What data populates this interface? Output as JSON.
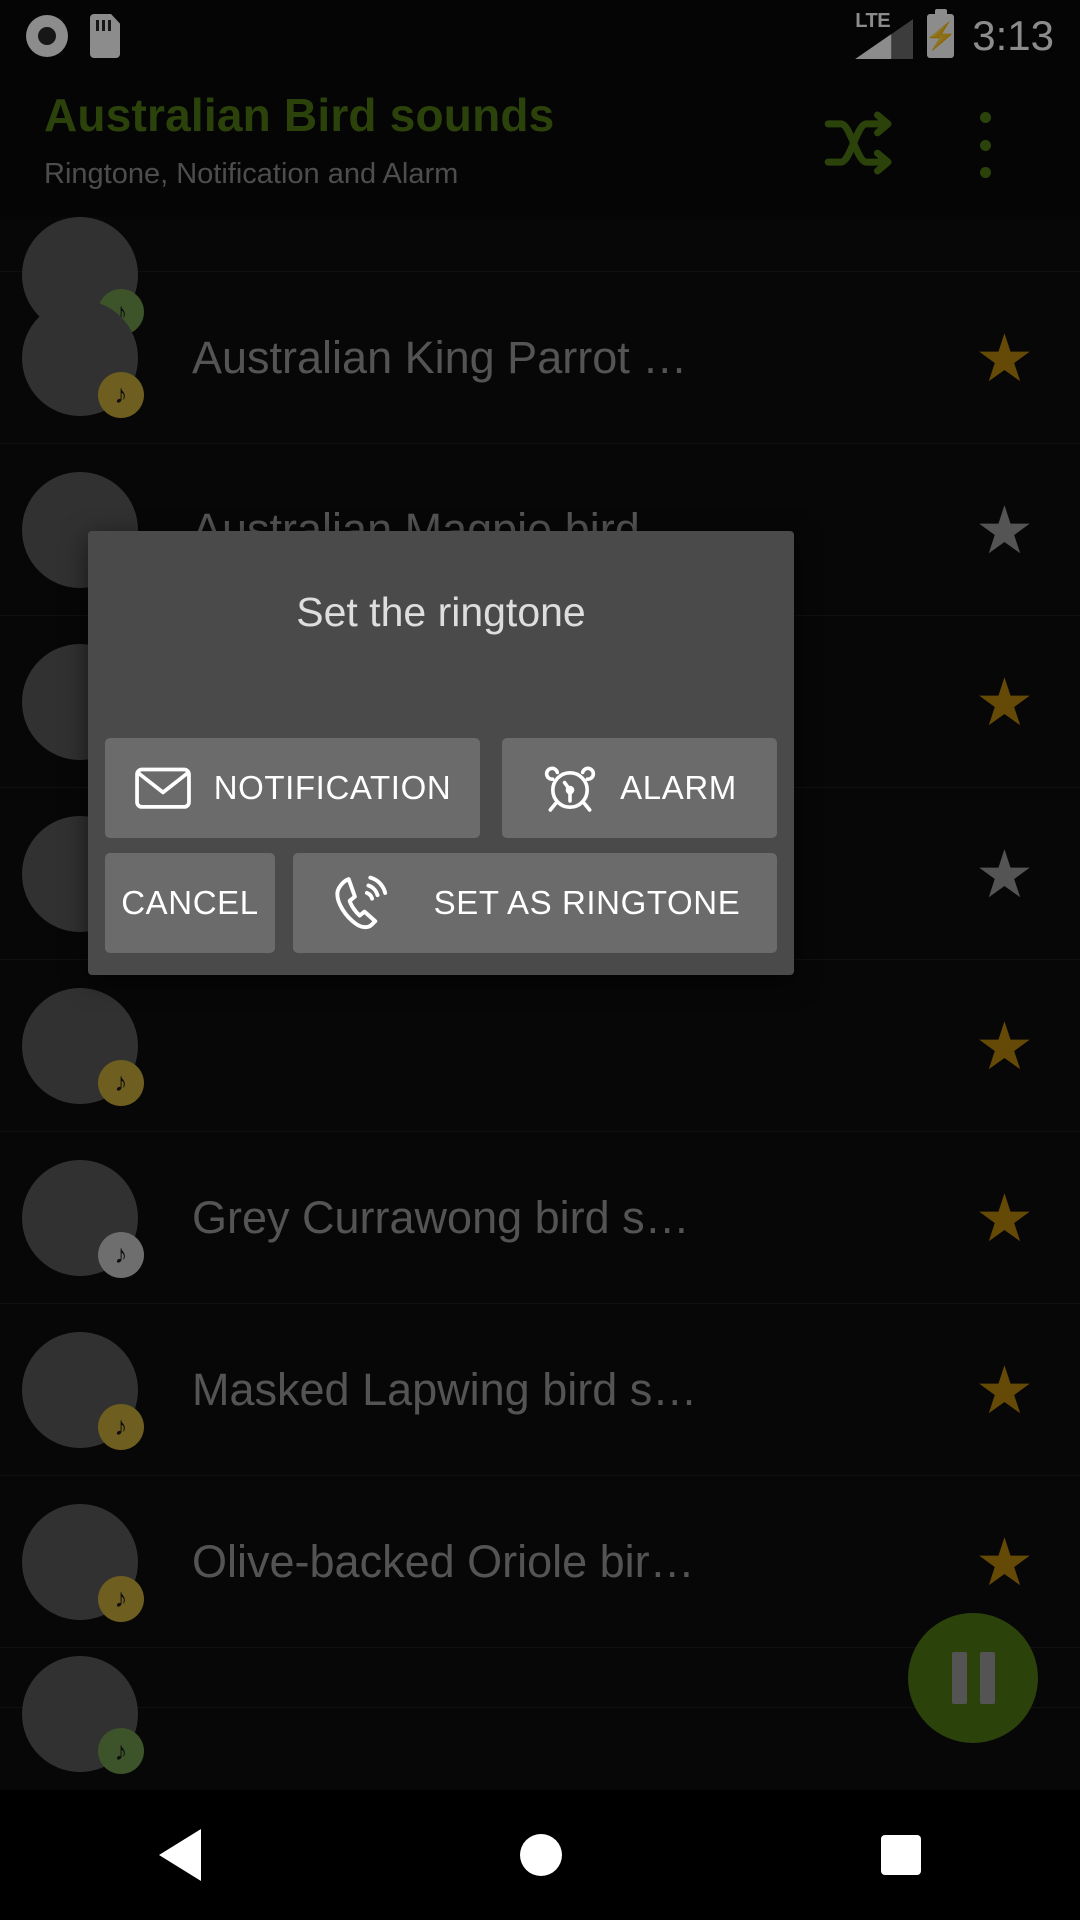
{
  "status_bar": {
    "time": "3:13",
    "network_label": "LTE",
    "icons": [
      "record-icon",
      "sd-card-icon",
      "lte-signal-icon",
      "battery-charging-icon"
    ]
  },
  "app_bar": {
    "title": "Australian Bird sounds",
    "subtitle": "Ringtone, Notification and Alarm",
    "shuffle_icon": "shuffle-icon",
    "overflow_icon": "overflow-menu-icon",
    "accent_color": "#4f7a15"
  },
  "list": {
    "items": [
      {
        "label": "",
        "starred": false,
        "art": "bird-finch",
        "badge_color": "#6f9a4e",
        "partial": true
      },
      {
        "label": "Australian King Parrot …",
        "starred": true,
        "art": "bird-parrot",
        "badge_color": "#c8ab3a",
        "partial": false
      },
      {
        "label": "Australian Magpie bird …",
        "starred": false,
        "art": "bird-magpie",
        "badge_color": "#6f9a4e",
        "partial": false
      },
      {
        "label": "",
        "starred": true,
        "art": "bird-currawong",
        "badge_color": "#c8c8c8",
        "partial": false
      },
      {
        "label": "",
        "starred": false,
        "art": "bird-plover",
        "badge_color": "#c8ab3a",
        "partial": false
      },
      {
        "label": "",
        "starred": true,
        "art": "bird-finch",
        "badge_color": "#c8ab3a",
        "partial": false
      },
      {
        "label": "Grey Currawong bird s…",
        "starred": true,
        "art": "bird-grey",
        "badge_color": "#c8c8c8",
        "partial": false
      },
      {
        "label": "Masked Lapwing bird s…",
        "starred": true,
        "art": "bird-lapwing",
        "badge_color": "#c8ab3a",
        "partial": false
      },
      {
        "label": "Olive-backed Oriole bir…",
        "starred": true,
        "art": "bird-oriole",
        "badge_color": "#c8ab3a",
        "partial": false
      },
      {
        "label": "",
        "starred": false,
        "art": "bird-lastpartial",
        "badge_color": "#6f9a4e",
        "partial": true
      }
    ],
    "music_note_glyph": "♪",
    "star_glyph": "★"
  },
  "player_fab": {
    "state": "playing",
    "icon": "pause-icon",
    "color": "#4f7a15"
  },
  "dialog": {
    "title": "Set the ringtone",
    "buttons": {
      "notification": {
        "label": "NOTIFICATION",
        "icon": "envelope-icon"
      },
      "alarm": {
        "label": "ALARM",
        "icon": "alarm-clock-icon"
      },
      "cancel": {
        "label": "CANCEL",
        "icon": ""
      },
      "set_as_ringtone": {
        "label": "SET AS RINGTONE",
        "icon": "phone-ringing-icon"
      }
    }
  },
  "nav_bar": {
    "back_label": "back-button",
    "home_label": "home-button",
    "recents_label": "recents-button"
  }
}
